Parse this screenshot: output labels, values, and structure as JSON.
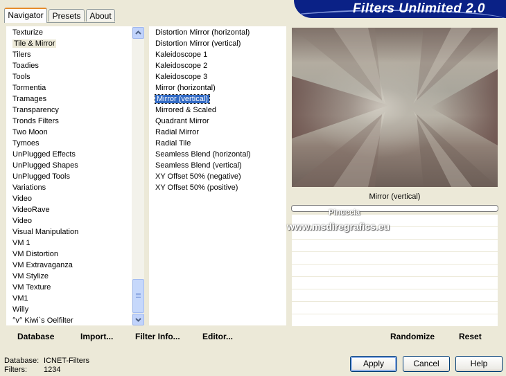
{
  "tabs": [
    "Navigator",
    "Presets",
    "About"
  ],
  "banner_title": "Filters Unlimited 2.0",
  "categories": [
    "Texturize",
    "Tile & Mirror",
    "Tilers",
    "Toadies",
    "Tools",
    "Tormentia",
    "Tramages",
    "Transparency",
    "Tronds Filters",
    "Two Moon",
    "Tymoes",
    "UnPlugged Effects",
    "UnPlugged Shapes",
    "UnPlugged Tools",
    "Variations",
    "Video",
    "VideoRave",
    "Video",
    "Visual Manipulation",
    "VM 1",
    "VM Distortion",
    "VM Extravaganza",
    "VM Stylize",
    "VM Texture",
    "VM1",
    "Willy",
    "°v° Kiwi`s Oelfilter"
  ],
  "selected_category_index": 1,
  "filters": [
    "Distortion Mirror (horizontal)",
    "Distortion Mirror (vertical)",
    "Kaleidoscope 1",
    "Kaleidoscope 2",
    "Kaleidoscope 3",
    "Mirror (horizontal)",
    "Mirror (vertical)",
    "Mirrored & Scaled",
    "Quadrant Mirror",
    "Radial Mirror",
    "Radial Tile",
    "Seamless Blend (horizontal)",
    "Seamless Blend (vertical)",
    "XY Offset 50% (negative)",
    "XY Offset 50% (positive)"
  ],
  "selected_filter_index": 6,
  "preview_caption": "Mirror (vertical)",
  "watermark_line1": "Pinuccia",
  "watermark_line2": "www.msdiregrafics.eu",
  "left_buttons": [
    "Database",
    "Import...",
    "Filter Info...",
    "Editor..."
  ],
  "right_buttons": [
    "Randomize",
    "Reset"
  ],
  "status": {
    "database_label": "Database:",
    "database_value": "ICNET-Filters",
    "filters_label": "Filters:",
    "filters_value": "1234"
  },
  "dialog_buttons": {
    "apply": "Apply",
    "cancel": "Cancel",
    "help": "Help"
  },
  "colors": {
    "accent": "#316ac5",
    "banner": "#0a2186",
    "tab_highlight": "#e68b2c"
  }
}
